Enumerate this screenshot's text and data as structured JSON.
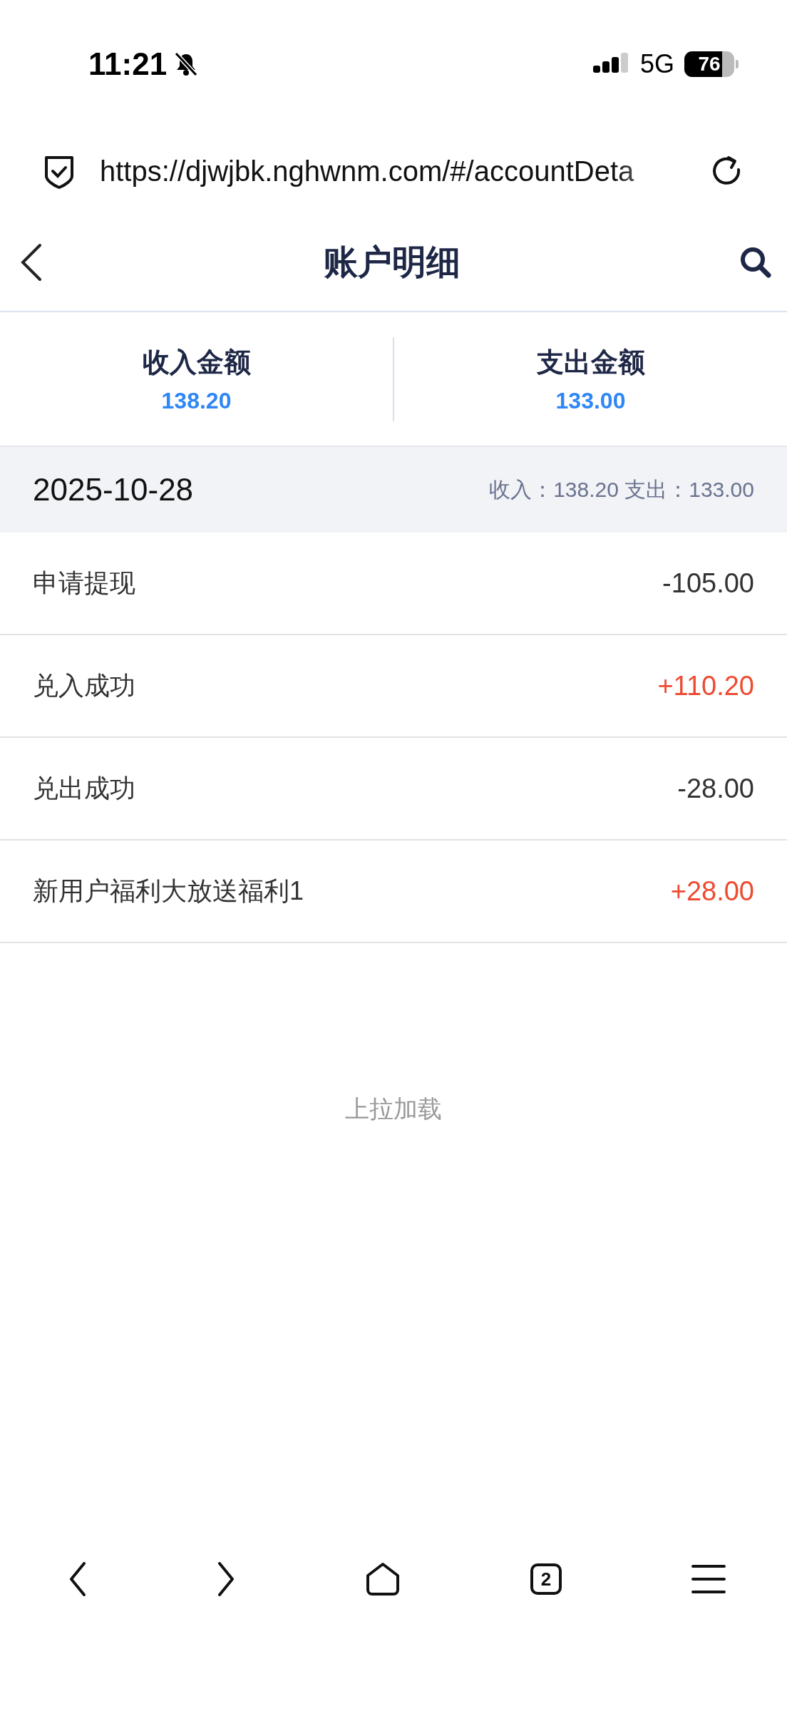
{
  "status_bar": {
    "time": "11:21",
    "network": "5G",
    "battery": "76"
  },
  "browser": {
    "url": "https://djwjbk.nghwnm.com/#/accountDeta",
    "tab_count": "2"
  },
  "header": {
    "title": "账户明细"
  },
  "summary": [
    {
      "label": "收入金额",
      "value": "138.20"
    },
    {
      "label": "支出金额",
      "value": "133.00"
    }
  ],
  "day": {
    "date": "2025-10-28",
    "totals": "收入：138.20 支出：133.00"
  },
  "transactions": [
    {
      "title": "申请提现",
      "amount": "-105.00",
      "kind": "expense"
    },
    {
      "title": "兑入成功",
      "amount": "+110.20",
      "kind": "income"
    },
    {
      "title": "兑出成功",
      "amount": "-28.00",
      "kind": "expense"
    },
    {
      "title": "新用户福利大放送福利1",
      "amount": "+28.00",
      "kind": "income"
    }
  ],
  "load_more": "上拉加载"
}
